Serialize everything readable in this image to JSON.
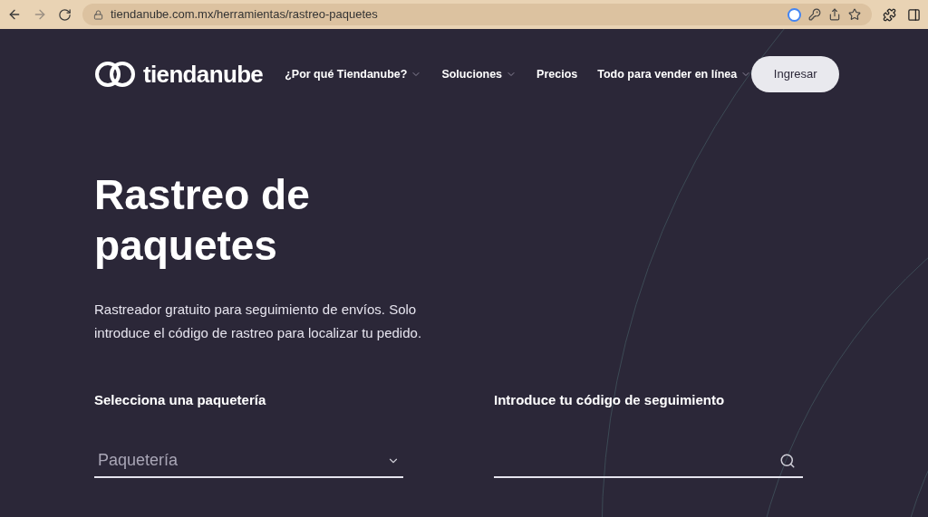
{
  "browser": {
    "url": "tiendanube.com.mx/herramientas/rastreo-paquetes"
  },
  "nav": {
    "logo": "tiendanube",
    "items": [
      {
        "label": "¿Por qué Tiendanube?",
        "has_menu": true
      },
      {
        "label": "Soluciones",
        "has_menu": true
      },
      {
        "label": "Precios",
        "has_menu": false
      },
      {
        "label": "Todo para vender en línea",
        "has_menu": true
      }
    ],
    "login_button": "Ingresar"
  },
  "hero": {
    "title_lines": [
      "Rastreo de",
      "paquetes"
    ],
    "subtitle": "Rastreador gratuito para seguimiento de envíos. Solo introduce el código de rastreo para localizar tu pedido."
  },
  "form": {
    "carrier": {
      "label": "Selecciona una paquetería",
      "placeholder": "Paquetería"
    },
    "tracking": {
      "label": "Introduce tu código de seguimiento"
    }
  }
}
